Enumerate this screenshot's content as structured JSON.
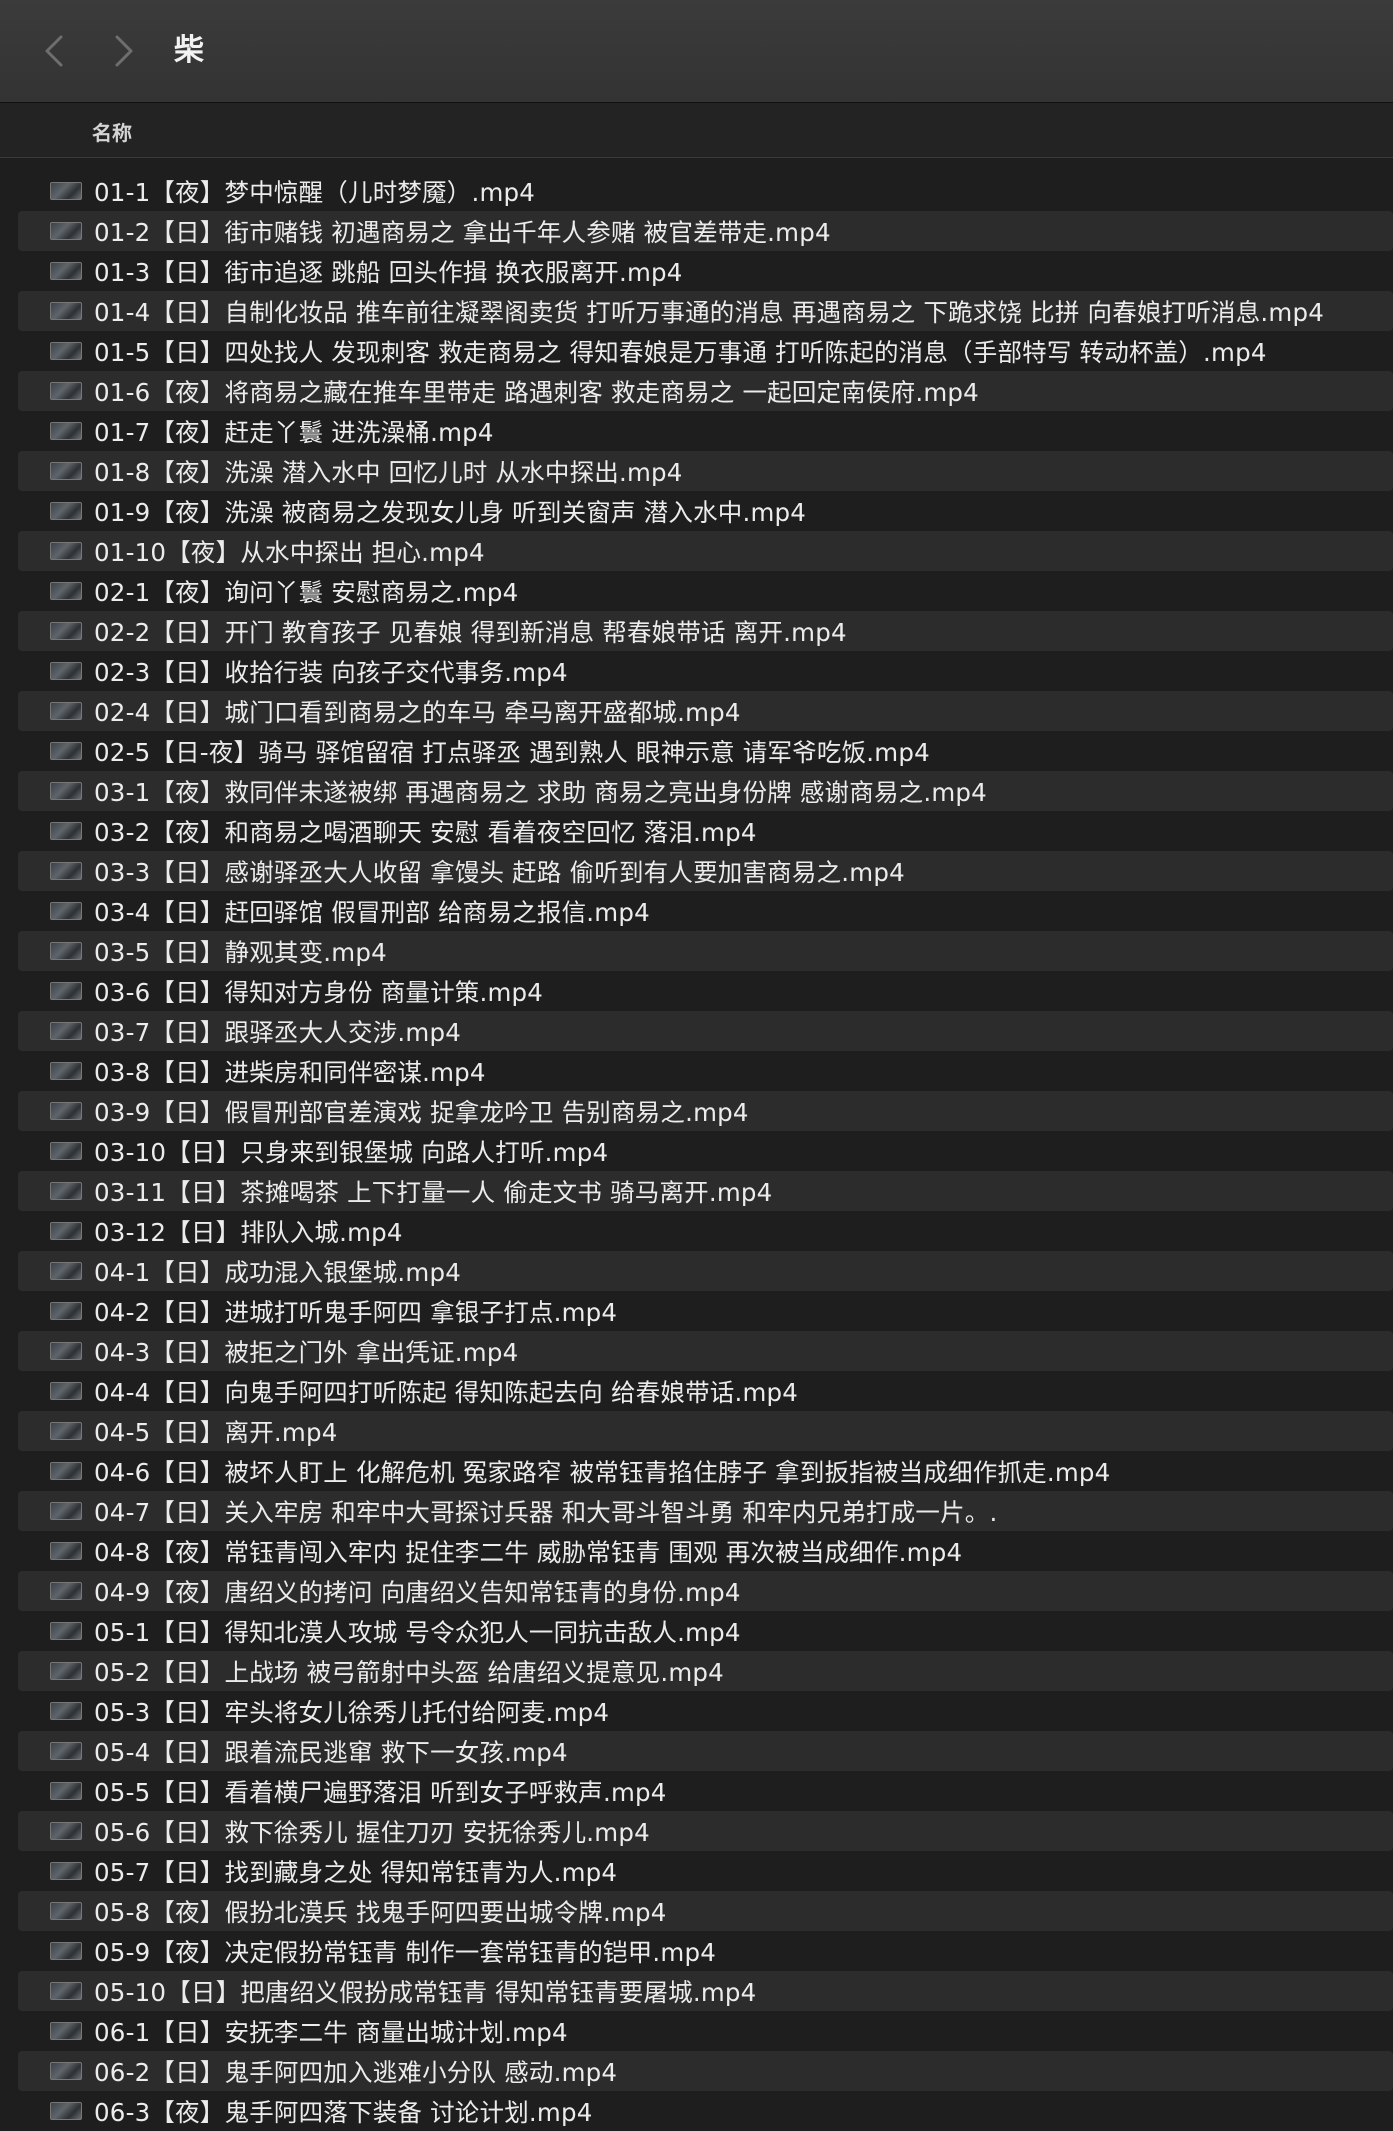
{
  "window": {
    "title": "柴"
  },
  "columns": {
    "name": "名称"
  },
  "files": [
    "01-1【夜】梦中惊醒（儿时梦魇）.mp4",
    "01-2【日】街市赌钱 初遇商易之 拿出千年人参赌 被官差带走.mp4",
    "01-3【日】街市追逐 跳船 回头作揖 换衣服离开.mp4",
    "01-4【日】自制化妆品 推车前往凝翠阁卖货 打听万事通的消息 再遇商易之 下跪求饶 比拼 向春娘打听消息.mp4",
    "01-5【日】四处找人 发现刺客 救走商易之 得知春娘是万事通 打听陈起的消息（手部特写 转动杯盖）.mp4",
    "01-6【夜】将商易之藏在推车里带走 路遇刺客 救走商易之 一起回定南侯府.mp4",
    "01-7【夜】赶走丫鬟 进洗澡桶.mp4",
    "01-8【夜】洗澡 潜入水中 回忆儿时 从水中探出.mp4",
    "01-9【夜】洗澡 被商易之发现女儿身 听到关窗声 潜入水中.mp4",
    "01-10【夜】从水中探出 担心.mp4",
    "02-1【夜】询问丫鬟 安慰商易之.mp4",
    "02-2【日】开门 教育孩子 见春娘 得到新消息 帮春娘带话 离开.mp4",
    "02-3【日】收拾行装 向孩子交代事务.mp4",
    "02-4【日】城门口看到商易之的车马 牵马离开盛都城.mp4",
    "02-5【日-夜】骑马 驿馆留宿 打点驿丞 遇到熟人 眼神示意 请军爷吃饭.mp4",
    "03-1【夜】救同伴未遂被绑 再遇商易之 求助 商易之亮出身份牌 感谢商易之.mp4",
    "03-2【夜】和商易之喝酒聊天 安慰 看着夜空回忆 落泪.mp4",
    "03-3【日】感谢驿丞大人收留 拿馒头 赶路 偷听到有人要加害商易之.mp4",
    "03-4【日】赶回驿馆 假冒刑部 给商易之报信.mp4",
    "03-5【日】静观其变.mp4",
    "03-6【日】得知对方身份 商量计策.mp4",
    "03-7【日】跟驿丞大人交涉.mp4",
    "03-8【日】进柴房和同伴密谋.mp4",
    "03-9【日】假冒刑部官差演戏 捉拿龙吟卫 告别商易之.mp4",
    "03-10【日】只身来到银堡城 向路人打听.mp4",
    "03-11【日】茶摊喝茶 上下打量一人 偷走文书 骑马离开.mp4",
    "03-12【日】排队入城.mp4",
    "04-1【日】成功混入银堡城.mp4",
    "04-2【日】进城打听鬼手阿四 拿银子打点.mp4",
    "04-3【日】被拒之门外 拿出凭证.mp4",
    "04-4【日】向鬼手阿四打听陈起 得知陈起去向 给春娘带话.mp4",
    "04-5【日】离开.mp4",
    "04-6【日】被坏人盯上 化解危机 冤家路窄 被常钰青掐住脖子 拿到扳指被当成细作抓走.mp4",
    "04-7【日】关入牢房 和牢中大哥探讨兵器 和大哥斗智斗勇 和牢内兄弟打成一片。.",
    "04-8【夜】常钰青闯入牢内 捉住李二牛 威胁常钰青 围观 再次被当成细作.mp4",
    "04-9【夜】唐绍义的拷问 向唐绍义告知常钰青的身份.mp4",
    "05-1【日】得知北漠人攻城 号令众犯人一同抗击敌人.mp4",
    "05-2【日】上战场 被弓箭射中头盔 给唐绍义提意见.mp4",
    "05-3【日】牢头将女儿徐秀儿托付给阿麦.mp4",
    "05-4【日】跟着流民逃窜 救下一女孩.mp4",
    "05-5【日】看着横尸遍野落泪 听到女子呼救声.mp4",
    "05-6【日】救下徐秀儿 握住刀刃 安抚徐秀儿.mp4",
    "05-7【日】找到藏身之处 得知常钰青为人.mp4",
    "05-8【夜】假扮北漠兵 找鬼手阿四要出城令牌.mp4",
    "05-9【夜】决定假扮常钰青 制作一套常钰青的铠甲.mp4",
    "05-10【日】把唐绍义假扮成常钰青 得知常钰青要屠城.mp4",
    "06-1【日】安抚李二牛 商量出城计划.mp4",
    "06-2【日】鬼手阿四加入逃难小分队 感动.mp4",
    "06-3【夜】鬼手阿四落下装备 讨论计划.mp4"
  ]
}
